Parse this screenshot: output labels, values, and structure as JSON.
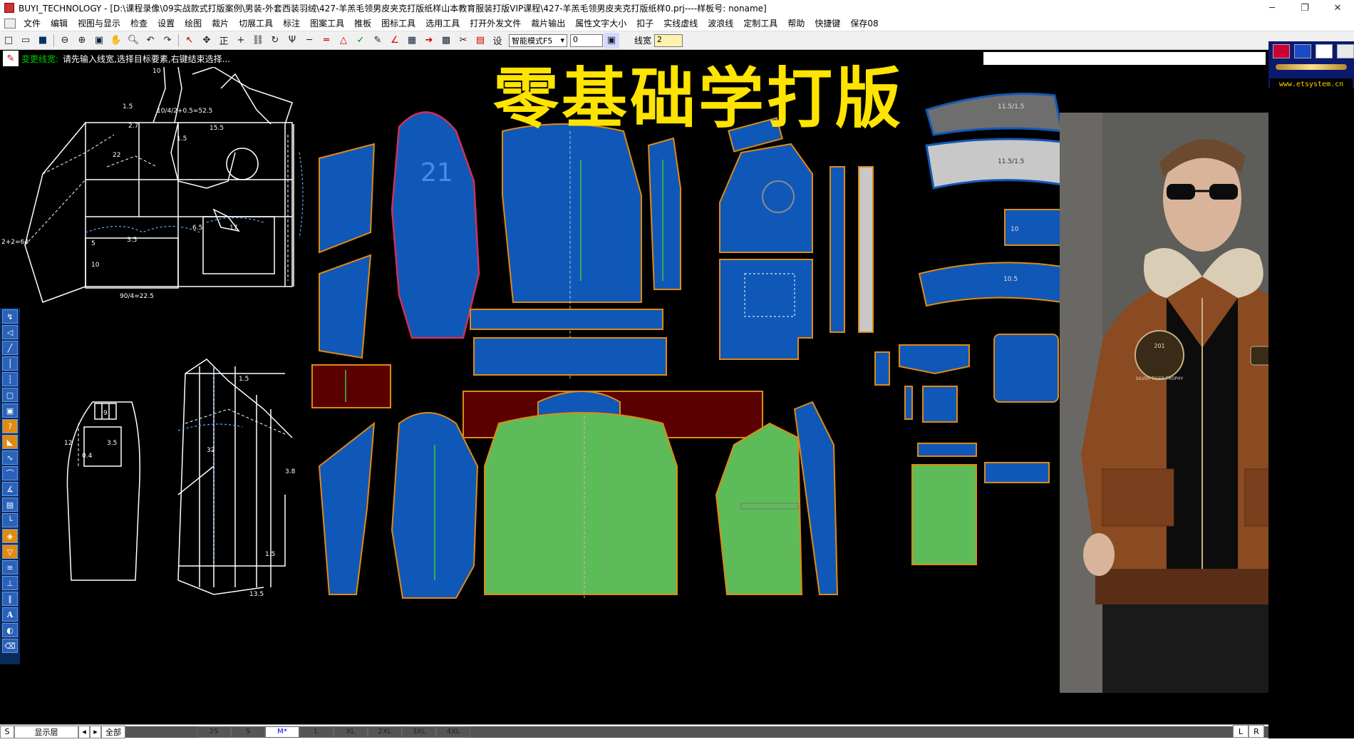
{
  "window": {
    "title": "BUYI_TECHNOLOGY - [D:\\课程录像\\09实战款式打版案例\\男装-外套西装羽绒\\427-羊羔毛领男皮夹克打版纸样山本教育服装打版VIP课程\\427-羊羔毛领男皮夹克打版纸样0.prj----样板号: noname]",
    "minimize": "─",
    "restore": "❐",
    "close": "✕"
  },
  "menu": [
    "文件",
    "编辑",
    "视图与显示",
    "检查",
    "设置",
    "绘图",
    "裁片",
    "切展工具",
    "标注",
    "图案工具",
    "推板",
    "图标工具",
    "选用工具",
    "打开外发文件",
    "裁片输出",
    "属性文字大小",
    "扣子",
    "实线虚线",
    "波浪线",
    "定制工具",
    "帮助",
    "快捷键",
    "保存08"
  ],
  "toolbar": {
    "mode_select": "智能模式F5",
    "value_input": "0",
    "linewidth_label": "线宽",
    "linewidth_value": "2"
  },
  "prompt": {
    "command": "变更线宽:",
    "message": "请先输入线宽,选择目标要素,右键结束选择..."
  },
  "overlay_title": "零基础学打版",
  "right_panel": {
    "url": "www.etsystem.cn"
  },
  "pattern_labels": {
    "sleeve_number": "21",
    "p1": "10",
    "p2": "10/4/2+0.5=52.5",
    "p3": "15.5",
    "p4": "2+2=64",
    "p5": "1.5",
    "p6": "2.7",
    "p7": "22",
    "p8": "1.5",
    "p9": "3.5",
    "p10": "17",
    "p11": "6.5",
    "p12": "5",
    "p13": "10",
    "p14": "90/4=22.5",
    "p15": "12",
    "p16": "9",
    "p17": "3.5",
    "p18": "0.4",
    "p19": "1.5",
    "p20": "32",
    "p21": "3.8",
    "p22": "1.5",
    "p23": "13.5",
    "collar1": "11.5/1.5",
    "collar2": "11.5/1.5",
    "c3": "10",
    "c4": "10.5"
  },
  "status": {
    "s_btn": "S",
    "layer_label": "显示层",
    "all_label": "全部",
    "sizes": [
      "2S",
      "S",
      "M*",
      "L",
      "XL",
      "2XL",
      "3XL",
      "4XL"
    ],
    "active_size": "M*",
    "l_btn": "L",
    "r_btn": "R"
  },
  "colors": {
    "pattern_blue": "#1058b8",
    "pattern_green": "#5ebb5a",
    "pattern_maroon": "#5a0000",
    "pattern_gray": "#6e6e6e",
    "pattern_lightgray": "#c8c8c8",
    "seam_orange": "#e08a10",
    "title_yellow": "#ffe400"
  },
  "jacket_badge": {
    "line1": "201",
    "line2": "SILVER TIGER TROPHY"
  }
}
